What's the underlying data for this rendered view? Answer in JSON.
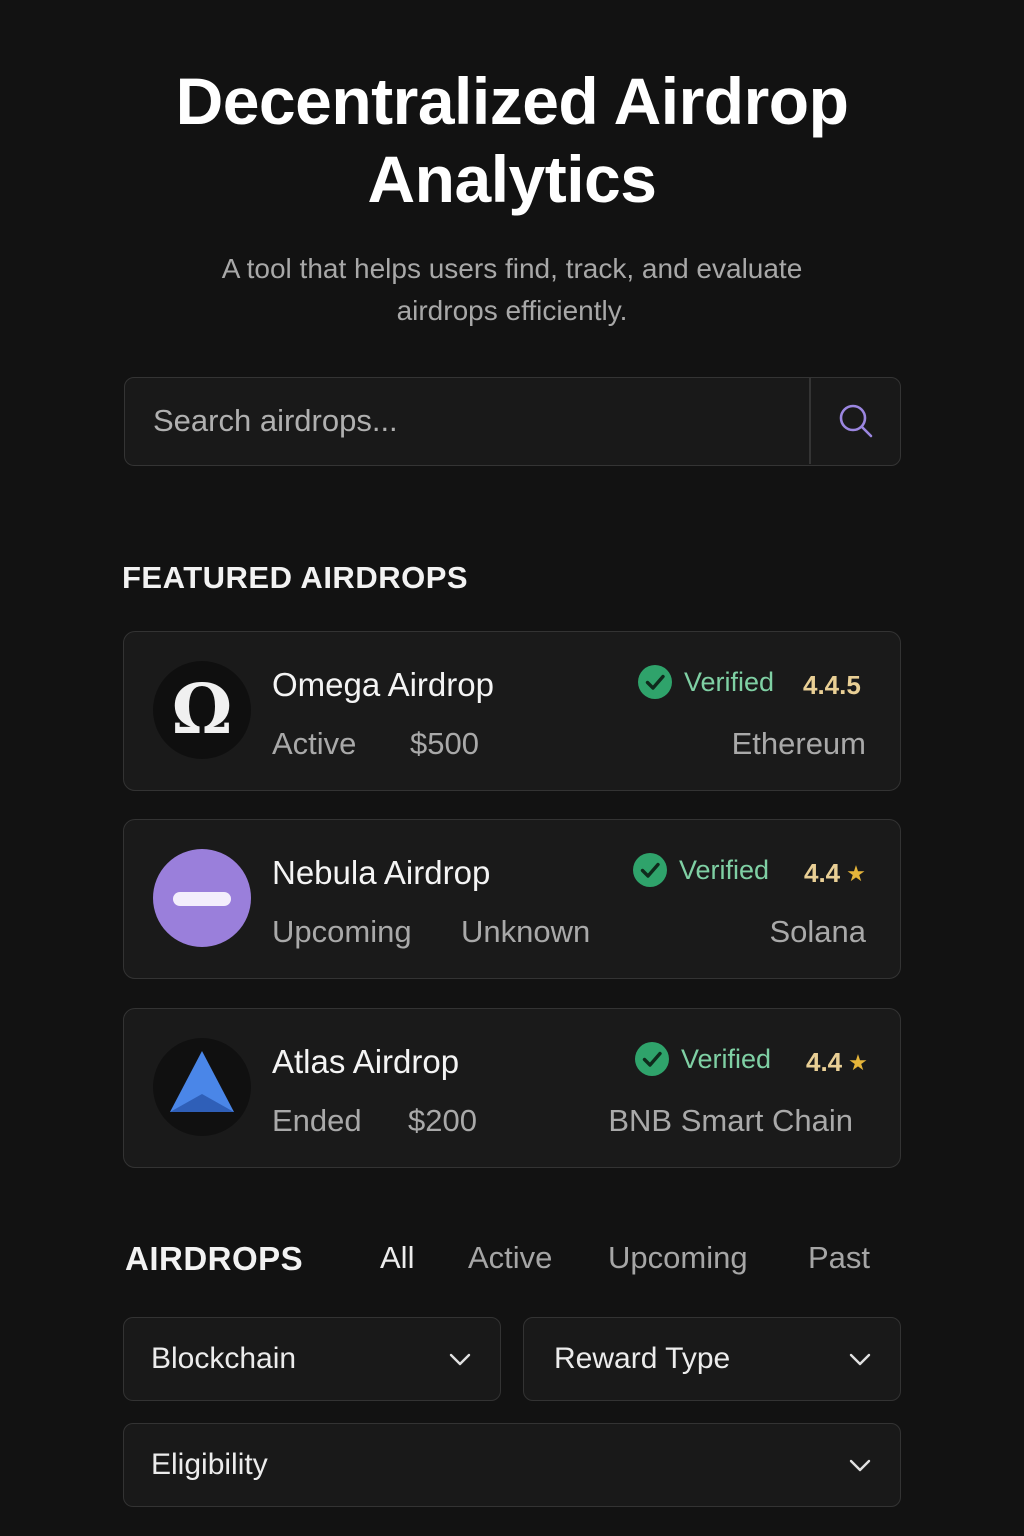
{
  "hero": {
    "title_line1": "Decentralized Airdrop",
    "title_line2": "Analytics",
    "subtitle_line1": "A tool that helps users find, track, and evaluate",
    "subtitle_line2": "airdrops efficiently."
  },
  "search": {
    "placeholder": "Search airdrops...",
    "icon": "search-icon"
  },
  "featured": {
    "heading": "FEATURED AIRDROPS",
    "items": [
      {
        "name": "Omega Airdrop",
        "status": "Active",
        "reward": "$500",
        "chain": "Ethereum",
        "verified_label": "Verified",
        "rating": "4.4.5",
        "logo_icon": "omega-icon",
        "logo_glyph": "Ω"
      },
      {
        "name": "Nebula Airdrop",
        "status": "Upcoming",
        "reward": "Unknown",
        "chain": "Solana",
        "verified_label": "Verified",
        "rating": "4.4",
        "logo_icon": "nebula-icon"
      },
      {
        "name": "Atlas Airdrop",
        "status": "Ended",
        "reward": "$200",
        "chain": "BNB Smart Chain",
        "verified_label": "Verified",
        "rating": "4.4",
        "logo_icon": "atlas-triangle-icon"
      }
    ]
  },
  "airdrops": {
    "heading": "AIRDROPS",
    "tabs": [
      "All",
      "Active",
      "Upcoming",
      "Past"
    ],
    "active_tab": "All",
    "filters": {
      "blockchain": "Blockchain",
      "reward_type": "Reward Type",
      "eligibility": "Eligibility"
    }
  },
  "colors": {
    "background": "#121212",
    "card": "#1a1a1a",
    "border": "#333333",
    "verified_green": "#2fa36b",
    "verified_text": "#7fd0a4",
    "rating_text": "#e9cf95",
    "star": "#e5b53a",
    "accent_purple": "#9b86e0",
    "nebula_purple": "#9a7fdb",
    "atlas_blue": "#4a86e8"
  }
}
